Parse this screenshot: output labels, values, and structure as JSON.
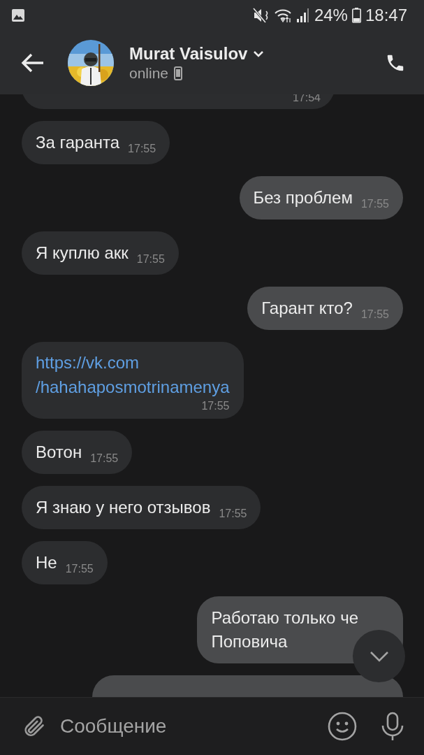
{
  "status_bar": {
    "battery": "24%",
    "time": "18:47"
  },
  "header": {
    "name": "Murat Vaisulov",
    "status": "online"
  },
  "messages": [
    {
      "kind": "partial",
      "outgoing": false,
      "time": "17:54"
    },
    {
      "kind": "text",
      "outgoing": false,
      "text": "За гаранта",
      "time": "17:55"
    },
    {
      "kind": "text",
      "outgoing": true,
      "text": "Без проблем",
      "time": "17:55"
    },
    {
      "kind": "text",
      "outgoing": false,
      "text": "Я куплю акк",
      "time": "17:55"
    },
    {
      "kind": "text",
      "outgoing": true,
      "text": "Гарант кто?",
      "time": "17:55"
    },
    {
      "kind": "link",
      "outgoing": false,
      "lines": [
        "https://vk.com",
        "/hahahaposmotrinamenya"
      ],
      "time": "17:55"
    },
    {
      "kind": "text",
      "outgoing": false,
      "text": "Вотон",
      "time": "17:55"
    },
    {
      "kind": "text",
      "outgoing": false,
      "text": "Я знаю у него отзывов",
      "time": "17:55"
    },
    {
      "kind": "text",
      "outgoing": false,
      "text": "Не",
      "time": "17:55"
    },
    {
      "kind": "covered",
      "outgoing": true,
      "lines": [
        "Работаю только че",
        "Поповича"
      ]
    },
    {
      "kind": "partial",
      "outgoing": true
    }
  ],
  "composer": {
    "placeholder": "Сообщение"
  }
}
